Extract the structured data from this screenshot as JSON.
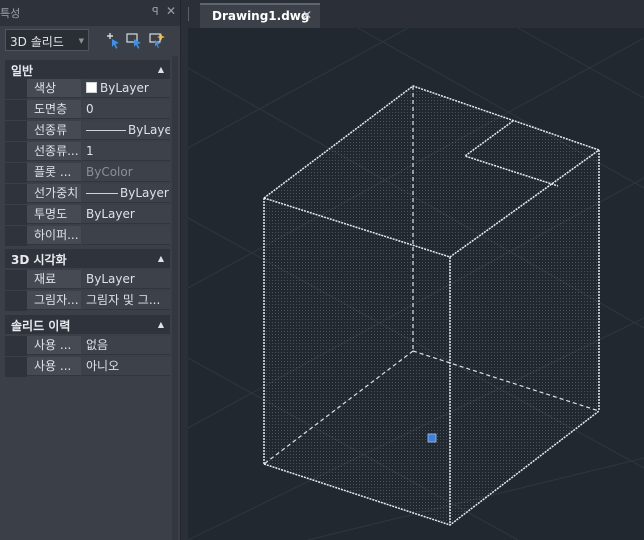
{
  "palette": {
    "title": "특성",
    "pin_glyph": "ꟼ",
    "close_glyph": "✕",
    "selector": {
      "value": "3D 솔리드"
    },
    "tools": [
      "toggle-pickadd-icon",
      "select-objects-icon",
      "quick-select-icon"
    ],
    "sections": [
      {
        "label": "일반",
        "rows": [
          {
            "key": "색상",
            "value": "ByLayer",
            "swatch": "#ffffff"
          },
          {
            "key": "도면층",
            "value": "0"
          },
          {
            "key": "선종류",
            "value": "ByLayer",
            "line": true
          },
          {
            "key": "선종류...",
            "value": "1"
          },
          {
            "key": "플롯 ...",
            "value": "ByColor",
            "dim": true
          },
          {
            "key": "선가중치",
            "value": "ByLayer",
            "line": true
          },
          {
            "key": "투명도",
            "value": "ByLayer"
          },
          {
            "key": "하이퍼...",
            "value": ""
          }
        ]
      },
      {
        "label": "3D 시각화",
        "rows": [
          {
            "key": "재료",
            "value": "ByLayer"
          },
          {
            "key": "그림자...",
            "value": "그림자 및 그..."
          }
        ]
      },
      {
        "label": "솔리드 이력",
        "rows": [
          {
            "key": "사용 ...",
            "value": "없음"
          },
          {
            "key": "사용 ...",
            "value": "아니오"
          }
        ]
      }
    ]
  },
  "document_tab": {
    "name": "Drawing1.dwg",
    "close_glyph": "✕"
  },
  "colors": {
    "viewport_bg": "#212830",
    "grid_line": "#2e3640",
    "selected_edge": "#e8ecf0",
    "grip": "#3f7fd6"
  }
}
